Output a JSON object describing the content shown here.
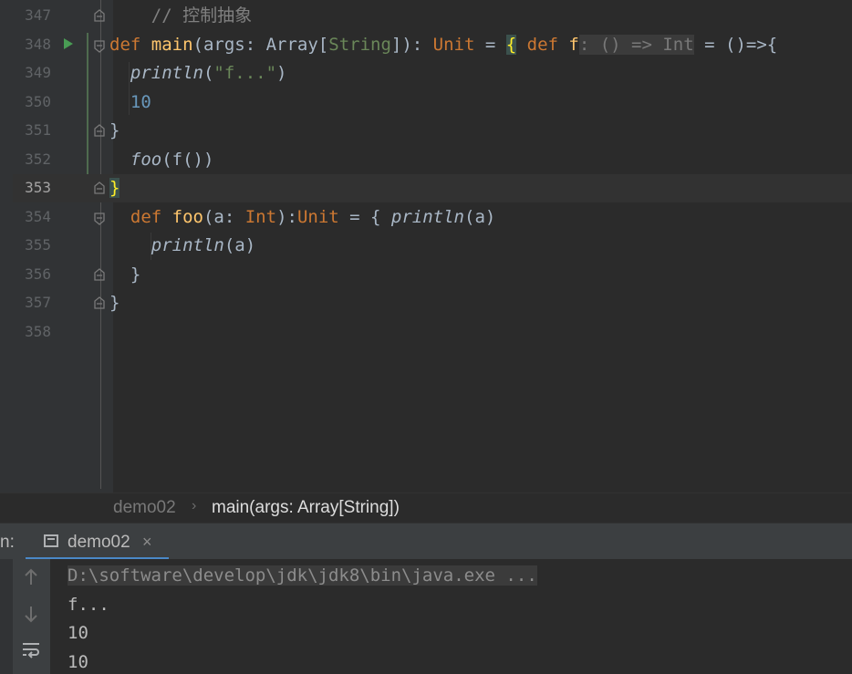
{
  "editor": {
    "lines": [
      {
        "num": "347",
        "current": false,
        "run": false,
        "fold": "end-up",
        "tokens": [
          [
            "cm",
            "    // 控制抽象"
          ]
        ]
      },
      {
        "num": "348",
        "current": false,
        "run": true,
        "fold": "start",
        "tokens": [
          [
            "kw",
            "def "
          ],
          [
            "fn",
            "main"
          ],
          [
            "",
            "(args: Array["
          ],
          [
            "str",
            "String"
          ],
          [
            "",
            "]): "
          ],
          [
            "kw",
            "Unit"
          ],
          [
            "",
            " = "
          ],
          [
            "brace",
            "{"
          ],
          [
            "kw",
            " def "
          ],
          [
            "fn",
            "f"
          ],
          [
            "hint",
            ": () => Int"
          ],
          [
            "",
            " = ()=>{"
          ]
        ]
      },
      {
        "num": "349",
        "current": false,
        "run": false,
        "fold": "",
        "tokens": [
          [
            "it",
            "  println"
          ],
          [
            "",
            "("
          ],
          [
            "str",
            "\"f...\""
          ],
          [
            "",
            ")"
          ]
        ]
      },
      {
        "num": "350",
        "current": false,
        "run": false,
        "fold": "",
        "tokens": [
          [
            "num",
            "  10"
          ]
        ]
      },
      {
        "num": "351",
        "current": false,
        "run": false,
        "fold": "end",
        "tokens": [
          [
            "",
            "}"
          ]
        ]
      },
      {
        "num": "352",
        "current": false,
        "run": false,
        "fold": "",
        "tokens": [
          [
            "it",
            "  foo"
          ],
          [
            "",
            "(f())"
          ]
        ]
      },
      {
        "num": "353",
        "current": true,
        "run": false,
        "fold": "end",
        "tokens": [
          [
            "brace",
            "}"
          ]
        ]
      },
      {
        "num": "354",
        "current": false,
        "run": false,
        "fold": "start",
        "tokens": [
          [
            "kw",
            "  def "
          ],
          [
            "fn",
            "foo"
          ],
          [
            "",
            "(a: "
          ],
          [
            "kw",
            "Int"
          ],
          [
            "",
            "):"
          ],
          [
            "kw",
            "Unit"
          ],
          [
            "",
            " = { "
          ],
          [
            "it",
            "println"
          ],
          [
            "",
            "(a)"
          ]
        ]
      },
      {
        "num": "355",
        "current": false,
        "run": false,
        "fold": "",
        "tokens": [
          [
            "it",
            "    println"
          ],
          [
            "",
            "(a)"
          ]
        ]
      },
      {
        "num": "356",
        "current": false,
        "run": false,
        "fold": "end",
        "tokens": [
          [
            "",
            "  }"
          ]
        ]
      },
      {
        "num": "357",
        "current": false,
        "run": false,
        "fold": "end",
        "tokens": [
          [
            "",
            "}"
          ]
        ]
      },
      {
        "num": "358",
        "current": false,
        "run": false,
        "fold": "",
        "tokens": [
          [
            "",
            ""
          ]
        ]
      }
    ]
  },
  "breadcrumb": {
    "items": [
      "demo02",
      "main(args: Array[String])"
    ],
    "separator": "›"
  },
  "tool_window": {
    "label": "n:",
    "tab_label": "demo02",
    "close": "×"
  },
  "console": {
    "lines": [
      "D:\\software\\develop\\jdk\\jdk8\\bin\\java.exe ...",
      "f...",
      "10",
      "10"
    ]
  },
  "sidebar_icons": [
    "arrow-up-icon",
    "arrow-down-icon",
    "soft-wrap-icon"
  ]
}
